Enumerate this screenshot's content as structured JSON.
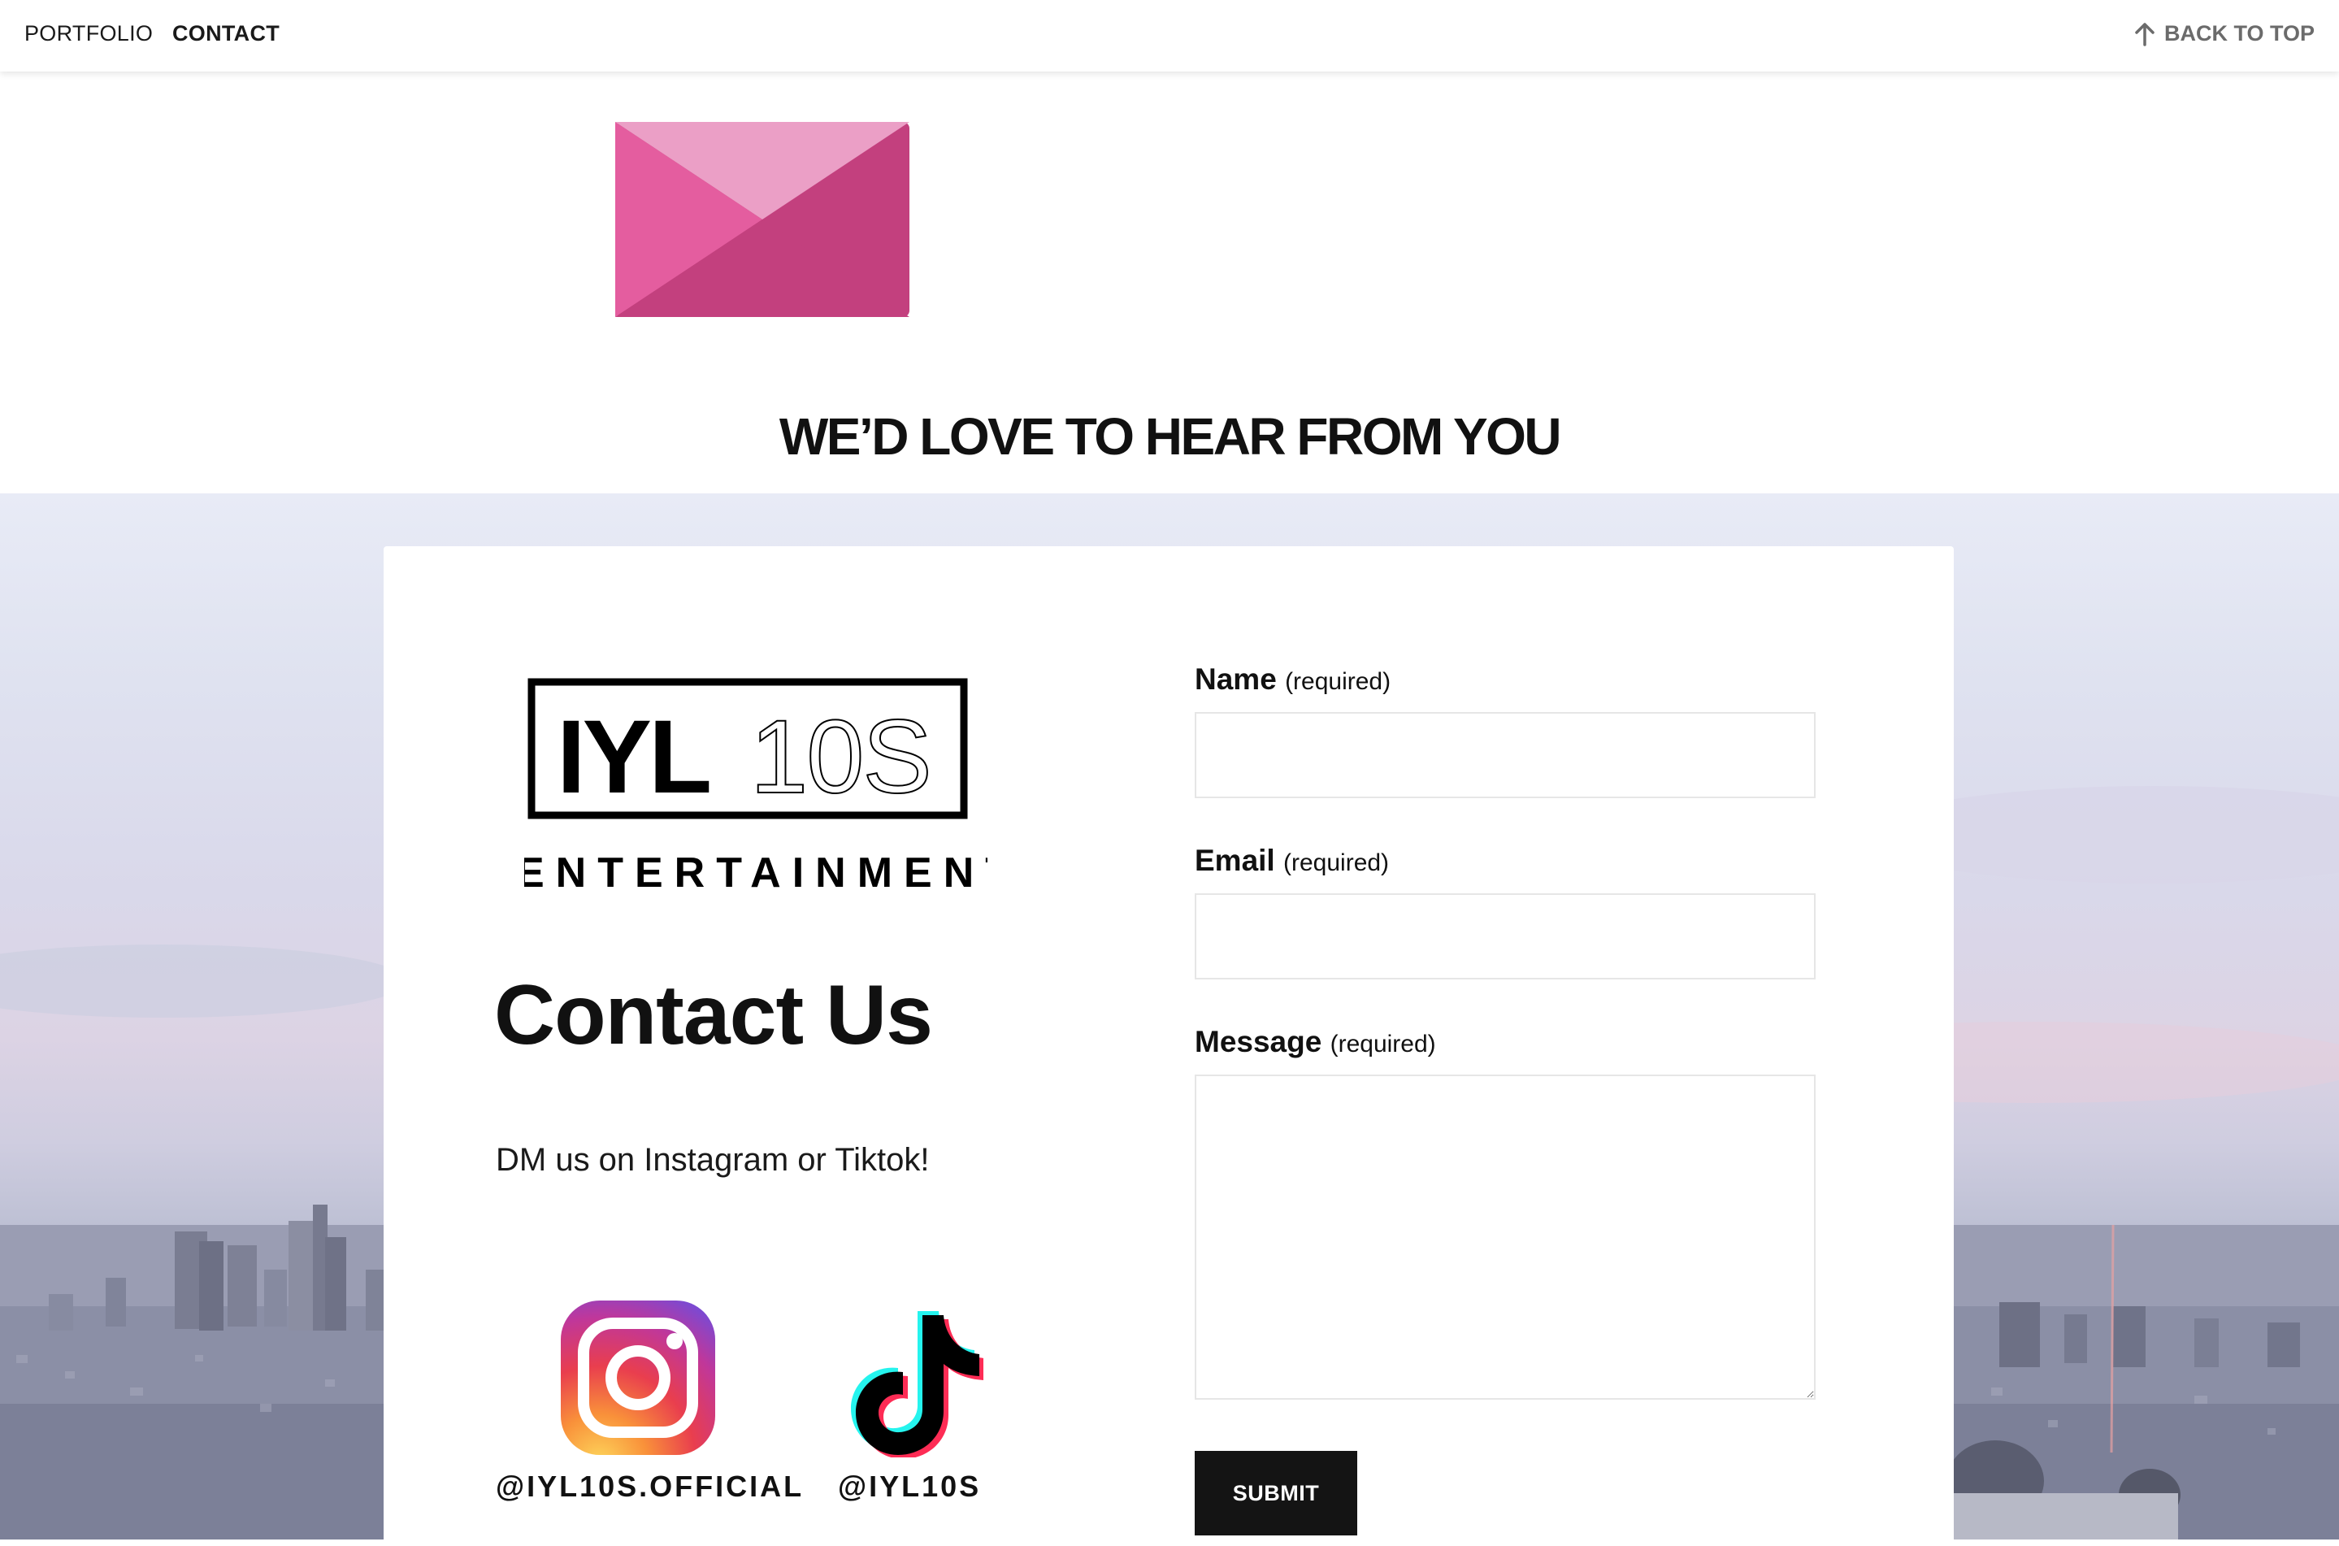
{
  "nav": {
    "portfolio_label": "PORTFOLIO",
    "contact_label": "CONTACT",
    "back_to_top_label": "BACK TO TOP"
  },
  "hero": {
    "heading": "WE’D LOVE TO HEAR FROM YOU"
  },
  "brand": {
    "logo_top_text": "IYL10S",
    "logo_bottom_text": "ENTERTAINMENT"
  },
  "contact": {
    "title": "Contact Us",
    "subtitle": "DM us on Instagram or Tiktok!",
    "instagram_handle": "@IYL10S.OFFICIAL",
    "tiktok_handle": "@IYL10S"
  },
  "form": {
    "name_label": "Name",
    "email_label": "Email",
    "message_label": "Message",
    "required_text": "(required)",
    "name_value": "",
    "email_value": "",
    "message_value": "",
    "submit_label": "SUBMIT"
  },
  "colors": {
    "envelope_light": "#eb9fc6",
    "envelope_mid": "#e45d9f",
    "envelope_dark": "#c3407e",
    "button_bg": "#141414"
  }
}
